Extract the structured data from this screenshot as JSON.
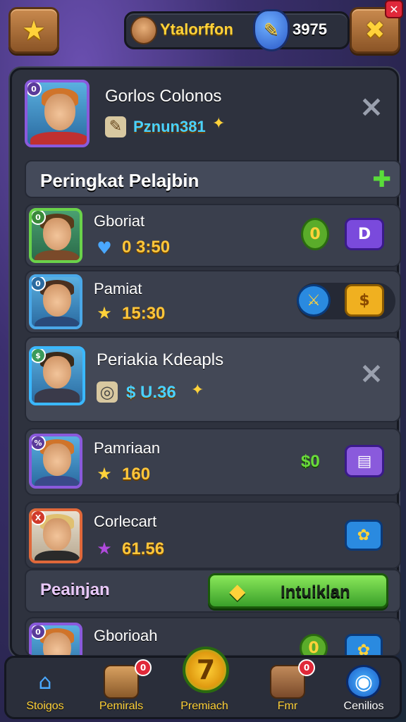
{
  "topbar": {
    "player_name": "Ytalorffon",
    "currency_value": "3975",
    "close_badge": "✕"
  },
  "profile": {
    "name": "Gorlos Colonos",
    "score": "Pznun381",
    "rank": "0"
  },
  "section_heading": "Peringkat Pelajbin",
  "entries": [
    {
      "name": "Gboriat",
      "value": "0 3:50",
      "rank": "0",
      "right_badge": "0",
      "action": "D"
    },
    {
      "name": "Pamiat",
      "value": "15:30",
      "rank": "0",
      "action": "$"
    },
    {
      "name": "Periakia Kdeapls",
      "value": "$ U.36",
      "rank": "$"
    },
    {
      "name": "Pamriaan",
      "value": "160",
      "rank": "%",
      "right_badge": "$0"
    },
    {
      "name": "Corlecart",
      "value": "61.56",
      "rank": "X"
    },
    {
      "name": "Gborioah",
      "value": "",
      "rank": "0",
      "right_badge": "0"
    }
  ],
  "cta": {
    "label": "Peainjan",
    "button": "Intuiklan"
  },
  "nav": [
    {
      "label": "Stoigos"
    },
    {
      "label": "Pemirals",
      "badge": "0"
    },
    {
      "label": "Premiach"
    },
    {
      "label": "Fmr",
      "badge": "0"
    },
    {
      "label": "Cenilios"
    }
  ]
}
